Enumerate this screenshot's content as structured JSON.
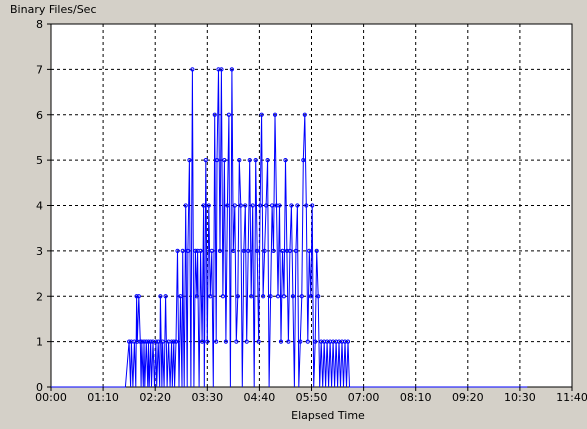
{
  "chart_data": {
    "type": "line",
    "title": "Binary Files/Sec",
    "xlabel": "Elapsed Time",
    "ylabel": "",
    "ylim": [
      0,
      8
    ],
    "xlim_minutes": [
      0,
      700
    ],
    "grid": true,
    "x_tick_labels": [
      "00:00",
      "01:10",
      "02:20",
      "03:30",
      "04:40",
      "05:50",
      "07:00",
      "08:10",
      "09:20",
      "10:30",
      "11:40"
    ],
    "y_tick_labels": [
      "0",
      "1",
      "2",
      "3",
      "4",
      "5",
      "6",
      "7",
      "8"
    ],
    "colors": {
      "series": "#0000ff",
      "plot_background": "#ffffff",
      "frame": "#d4d0c8",
      "grid": "#000000"
    },
    "series": [
      {
        "x": [
          0,
          100,
          105,
          107,
          108,
          110,
          112,
          114,
          115,
          116,
          118,
          120,
          121,
          122,
          124,
          125,
          126,
          128,
          130,
          131,
          132,
          134,
          135,
          137,
          139,
          141,
          142,
          144,
          146,
          147,
          149,
          150,
          152,
          154,
          156,
          158,
          160,
          162,
          163,
          165,
          166,
          168,
          170,
          172,
          174,
          176,
          177,
          179,
          181,
          183,
          184,
          186,
          188,
          190,
          192,
          194,
          196,
          197,
          199,
          201,
          203,
          205,
          206,
          208,
          210,
          212,
          214,
          216,
          218,
          220,
          222,
          223,
          225,
          227,
          229,
          231,
          233,
          235,
          237,
          239,
          241,
          243,
          245,
          247,
          249,
          251,
          253,
          255,
          257,
          259,
          261,
          263,
          265,
          267,
          269,
          271,
          273,
          275,
          277,
          279,
          281,
          283,
          285,
          287,
          289,
          291,
          293,
          295,
          297,
          299,
          301,
          303,
          305,
          307,
          309,
          311,
          313,
          315,
          317,
          319,
          321,
          323,
          325,
          327,
          329,
          331,
          333,
          335,
          337,
          339,
          341,
          343,
          345,
          347,
          349,
          351,
          353,
          355,
          357,
          359,
          361,
          363,
          365,
          367,
          369,
          371,
          373,
          375,
          377,
          379,
          381,
          383,
          385,
          387,
          389,
          391,
          393,
          395,
          397,
          399,
          401,
          403,
          405,
          407,
          409,
          411,
          413,
          415,
          417,
          419,
          421,
          423,
          425,
          427,
          429,
          431,
          640
        ],
        "y": [
          0,
          0,
          1,
          0,
          1,
          0,
          1,
          0,
          2,
          1,
          2,
          1,
          0,
          1,
          0,
          1,
          0,
          1,
          0,
          1,
          0,
          1,
          0,
          1,
          0,
          1,
          0,
          1,
          0,
          2,
          0,
          1,
          0,
          2,
          0,
          1,
          0,
          1,
          0,
          1,
          0,
          1,
          3,
          0,
          2,
          0,
          3,
          0,
          4,
          0,
          3,
          5,
          0,
          7,
          0,
          3,
          2,
          3,
          0,
          3,
          1,
          4,
          0,
          5,
          1,
          4,
          2,
          3,
          0,
          6,
          1,
          5,
          7,
          3,
          7,
          2,
          5,
          1,
          4,
          6,
          0,
          7,
          3,
          4,
          1,
          2,
          5,
          4,
          0,
          3,
          4,
          1,
          3,
          5,
          2,
          4,
          0,
          5,
          3,
          1,
          4,
          6,
          2,
          3,
          4,
          5,
          0,
          2,
          4,
          3,
          6,
          4,
          2,
          4,
          1,
          3,
          2,
          5,
          3,
          1,
          3,
          4,
          2,
          0,
          3,
          4,
          0,
          1,
          2,
          5,
          6,
          4,
          1,
          3,
          2,
          4,
          0,
          1,
          3,
          2,
          0,
          1,
          0,
          1,
          0,
          1,
          0,
          1,
          0,
          1,
          0,
          1,
          0,
          1,
          0,
          1,
          0,
          1,
          0,
          1,
          0,
          0,
          0,
          0,
          0,
          0,
          0,
          0,
          0,
          0,
          0,
          0,
          0,
          0,
          0,
          0,
          0
        ]
      }
    ]
  }
}
